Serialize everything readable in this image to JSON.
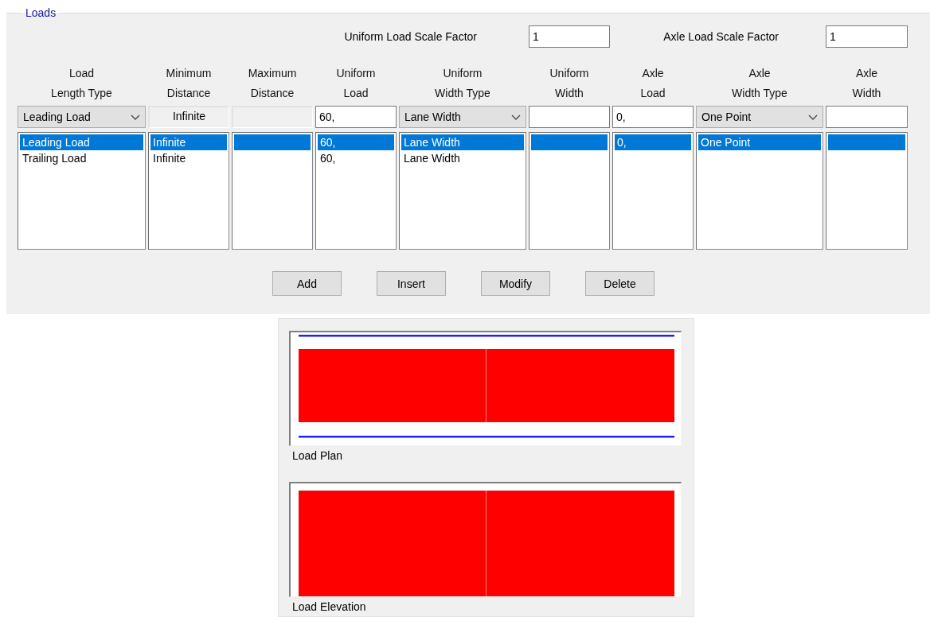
{
  "group": {
    "title": "Loads"
  },
  "scale_factors": [
    {
      "label": "Uniform Load Scale Factor",
      "value": "1"
    },
    {
      "label": "Axle Load Scale Factor",
      "value": "1"
    }
  ],
  "columns": [
    {
      "header": [
        "Load",
        "Length Type"
      ],
      "editor": {
        "kind": "dropdown",
        "value": "Leading Load"
      },
      "items": [
        {
          "text": "Leading Load",
          "selected": true
        },
        {
          "text": "Trailing Load",
          "selected": false
        }
      ]
    },
    {
      "header": [
        "Minimum",
        "Distance"
      ],
      "editor": {
        "kind": "readonly",
        "value": "Infinite"
      },
      "items": [
        {
          "text": "Infinite",
          "selected": true
        },
        {
          "text": "Infinite",
          "selected": false
        }
      ]
    },
    {
      "header": [
        "Maximum",
        "Distance"
      ],
      "editor": {
        "kind": "readonly"
      },
      "items": [
        {
          "selected": true
        }
      ]
    },
    {
      "header": [
        "Uniform",
        "Load"
      ],
      "editor": {
        "kind": "input",
        "value": "60,"
      },
      "items": [
        {
          "text": "60,",
          "selected": true
        },
        {
          "text": "60,",
          "selected": false
        }
      ]
    },
    {
      "header": [
        "Uniform",
        "Width Type"
      ],
      "editor": {
        "kind": "dropdown",
        "value": "Lane Width"
      },
      "items": [
        {
          "text": "Lane Width",
          "selected": true
        },
        {
          "text": "Lane Width",
          "selected": false
        }
      ]
    },
    {
      "header": [
        "Uniform",
        "Width"
      ],
      "editor": {
        "kind": "input"
      },
      "items": [
        {
          "selected": true
        }
      ]
    },
    {
      "header": [
        "Axle",
        "Load"
      ],
      "editor": {
        "kind": "input",
        "value": "0,"
      },
      "items": [
        {
          "text": "0,",
          "selected": true
        }
      ]
    },
    {
      "header": [
        "Axle",
        "Width Type"
      ],
      "editor": {
        "kind": "dropdown",
        "value": "One Point"
      },
      "items": [
        {
          "text": "One Point",
          "selected": true
        }
      ]
    },
    {
      "header": [
        "Axle",
        "Width"
      ],
      "editor": {
        "kind": "input"
      },
      "items": [
        {
          "selected": true
        }
      ]
    }
  ],
  "buttons": [
    "Add",
    "Insert",
    "Modify",
    "Delete"
  ],
  "previews": [
    {
      "kind": "plan",
      "caption": "Load Plan"
    },
    {
      "kind": "elevation",
      "caption": "Load Elevation"
    }
  ]
}
